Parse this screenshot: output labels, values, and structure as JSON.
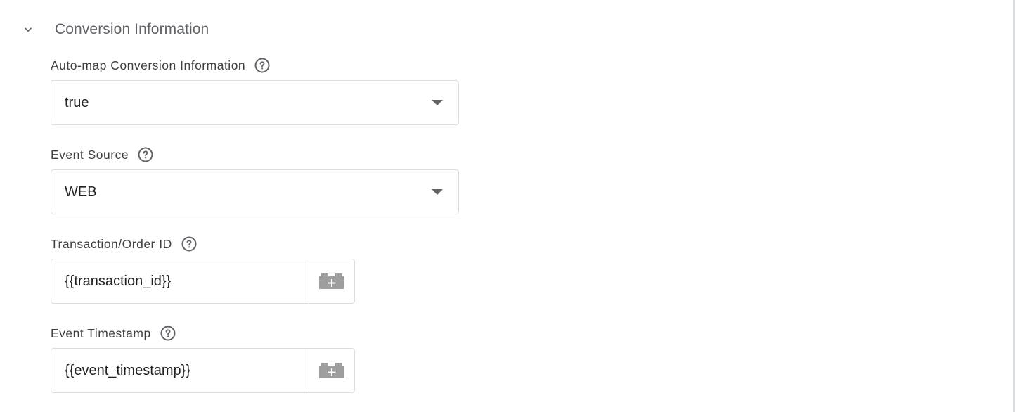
{
  "section": {
    "title": "Conversion Information",
    "expand_icon": "chevron-down-icon"
  },
  "fields": {
    "auto_map": {
      "label": "Auto-map Conversion Information",
      "value": "true",
      "help_icon": "help-circle-icon",
      "dropdown_icon": "dropdown-arrow-icon"
    },
    "event_source": {
      "label": "Event Source",
      "value": "WEB",
      "help_icon": "help-circle-icon",
      "dropdown_icon": "dropdown-arrow-icon"
    },
    "transaction_id": {
      "label": "Transaction/Order ID",
      "value": "{{transaction_id}}",
      "help_icon": "help-circle-icon",
      "variable_icon": "add-variable-brick-icon"
    },
    "event_timestamp": {
      "label": "Event Timestamp",
      "value": "{{event_timestamp}}",
      "help_icon": "help-circle-icon",
      "variable_icon": "add-variable-brick-icon"
    }
  },
  "colors": {
    "label": "#3c4043",
    "section_title": "#5f6368",
    "border": "#dadce0",
    "icon": "#5f6368",
    "brick_icon": "#9e9e9e"
  }
}
